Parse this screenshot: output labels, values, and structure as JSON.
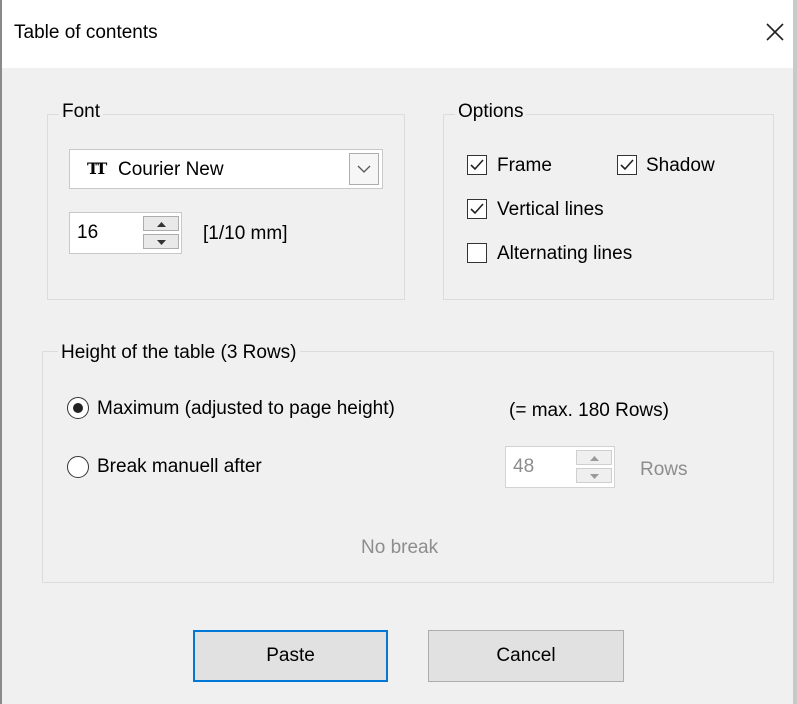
{
  "window": {
    "title": "Table of contents"
  },
  "font_group": {
    "legend": "Font",
    "font_name": "Courier New",
    "size_value": "16",
    "size_unit": "[1/10 mm]"
  },
  "options_group": {
    "legend": "Options",
    "frame": {
      "label": "Frame",
      "checked": true
    },
    "shadow": {
      "label": "Shadow",
      "checked": true
    },
    "vertical_lines": {
      "label": "Vertical lines",
      "checked": true
    },
    "alternating_lines": {
      "label": "Alternating lines",
      "checked": false
    }
  },
  "height_group": {
    "legend": "Height of the table (3 Rows)",
    "maximum_label": "Maximum (adjusted to page height)",
    "maximum_info": "(= max. 180 Rows)",
    "break_label": "Break manuell after",
    "break_value": "48",
    "rows_label": "Rows",
    "status": "No break"
  },
  "buttons": {
    "paste": "Paste",
    "cancel": "Cancel"
  },
  "colors": {
    "default_button_border": "#0078d7",
    "dialog_bg": "#f0f0f0"
  }
}
